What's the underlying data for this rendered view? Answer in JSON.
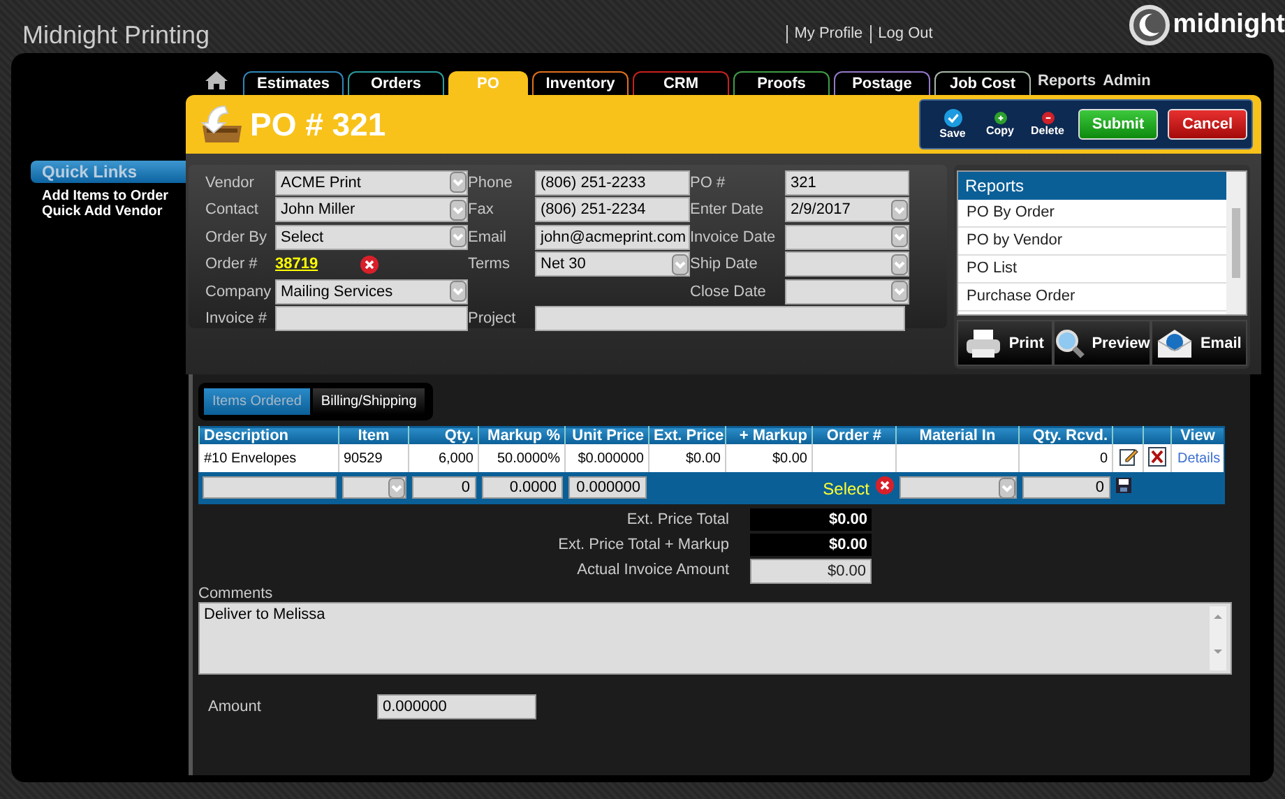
{
  "app_title": "Midnight Printing",
  "user_links": [
    "My Profile",
    "Log Out"
  ],
  "logo_text": "midnight",
  "sidebar": {
    "title": "Quick Links",
    "items": [
      "Add Items to Order",
      "Quick Add Vendor"
    ]
  },
  "nav_tabs": [
    {
      "label": "Estimates",
      "selected": false,
      "color": "#2f86b8"
    },
    {
      "label": "Orders",
      "selected": false,
      "color": "#2a9c9c"
    },
    {
      "label": "PO",
      "selected": true,
      "color": "#f8c21a"
    },
    {
      "label": "Inventory",
      "selected": false,
      "color": "#e0701e"
    },
    {
      "label": "CRM",
      "selected": false,
      "color": "#c8201e"
    },
    {
      "label": "Proofs",
      "selected": false,
      "color": "#3f9e46"
    },
    {
      "label": "Postage",
      "selected": false,
      "color": "#9478c8"
    },
    {
      "label": "Job Cost",
      "selected": false,
      "color": "#a8b8a8"
    }
  ],
  "nav_links": [
    "Reports",
    "Admin"
  ],
  "page_title": "PO # 321",
  "toolbar": {
    "actions": [
      {
        "kind": "save",
        "label": "Save"
      },
      {
        "kind": "copy",
        "label": "Copy"
      },
      {
        "kind": "delete",
        "label": "Delete"
      }
    ],
    "buttons": [
      {
        "kind": "submit",
        "label": "Submit"
      },
      {
        "kind": "cancel",
        "label": "Cancel"
      }
    ]
  },
  "form": {
    "rows": [
      [
        {
          "label": "Vendor",
          "kind": "select",
          "value": "ACME Print"
        },
        {
          "label": "Phone",
          "kind": "text",
          "value": "(806) 251-2233"
        },
        {
          "label": "PO #",
          "kind": "text",
          "value": "321"
        }
      ],
      [
        {
          "label": "Contact",
          "kind": "select",
          "value": "John Miller"
        },
        {
          "label": "Fax",
          "kind": "text",
          "value": "(806) 251-2234"
        },
        {
          "label": "Enter Date",
          "kind": "select",
          "value": "2/9/2017"
        }
      ],
      [
        {
          "label": "Order By",
          "kind": "select",
          "value": "Select"
        },
        {
          "label": "Email",
          "kind": "text",
          "value": "john@acmeprint.com"
        },
        {
          "label": "Invoice Date",
          "kind": "select"
        }
      ],
      [
        {
          "label": "Order #",
          "kind": "link",
          "value": "38719"
        },
        {
          "label": "Terms",
          "kind": "select",
          "value": "Net 30"
        },
        {
          "label": "Ship Date",
          "kind": "select"
        }
      ],
      [
        {
          "label": "Company",
          "kind": "select",
          "value": "Mailing Services"
        },
        {
          "kind": "blank"
        },
        {
          "label": "Close Date",
          "kind": "select"
        }
      ],
      [
        {
          "label": "Invoice #",
          "kind": "text"
        },
        {
          "label": "Project",
          "kind": "wide"
        }
      ]
    ]
  },
  "reports": {
    "title": "Reports",
    "items": [
      "PO By Order",
      "PO by Vendor",
      "PO List",
      "Purchase Order"
    ],
    "buttons": [
      {
        "kind": "print",
        "label": "Print"
      },
      {
        "kind": "preview",
        "label": "Preview"
      },
      {
        "kind": "email",
        "label": "Email"
      }
    ]
  },
  "detail_tabs": [
    {
      "label": "Items Ordered",
      "selected": true
    },
    {
      "label": "Billing/Shipping",
      "selected": false
    }
  ],
  "table": {
    "columns": [
      {
        "label": "Description"
      },
      {
        "label": "Item"
      },
      {
        "label": "Qty."
      },
      {
        "label": "Markup %"
      },
      {
        "label": "Unit Price"
      },
      {
        "label": "Ext. Price"
      },
      {
        "label": "+ Markup"
      },
      {
        "label": "Order #"
      },
      {
        "label": "Material In"
      },
      {
        "label": "Qty. Rcvd."
      },
      {},
      {},
      {
        "label": "View"
      }
    ],
    "rows": [
      {
        "cells": [
          {
            "text": "#10 Envelopes"
          },
          {
            "text": "90529"
          },
          {
            "text": "6,000"
          },
          {
            "text": "50.0000%"
          },
          {
            "text": "$0.000000"
          },
          {
            "text": "$0.00"
          },
          {
            "text": "$0.00"
          },
          {},
          {},
          {
            "text": "0"
          },
          {
            "kind": "edit"
          },
          {
            "kind": "delete"
          },
          {
            "kind": "link",
            "text": "Details"
          }
        ]
      }
    ],
    "entry_row": {
      "cells": [
        {
          "kind": "input"
        },
        {
          "kind": "select"
        },
        {
          "kind": "input",
          "text": "0"
        },
        {
          "kind": "input",
          "text": "0.0000"
        },
        {
          "kind": "input",
          "text": "0.000000"
        },
        {},
        {},
        {
          "kind": "link",
          "text": "Select"
        },
        {
          "kind": "select"
        },
        {
          "kind": "input",
          "text": "0"
        },
        {
          "kind": "save"
        },
        {},
        {}
      ]
    }
  },
  "totals": [
    {
      "label": "Ext. Price Total",
      "value": "$0.00",
      "kind": "dark"
    },
    {
      "label": "Ext. Price Total + Markup",
      "value": "$0.00",
      "kind": "dark"
    },
    {
      "label": "Actual Invoice Amount",
      "value": "$0.00",
      "kind": "field"
    }
  ],
  "comments": {
    "label": "Comments",
    "value": "Deliver to Melissa"
  },
  "amount": {
    "label": "Amount",
    "value": "0.000000"
  }
}
